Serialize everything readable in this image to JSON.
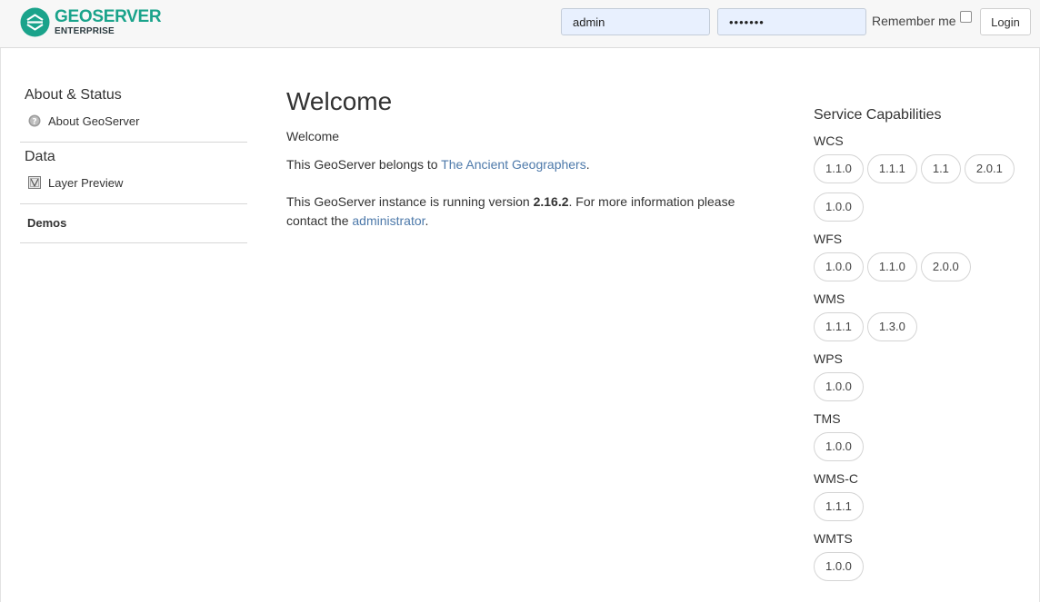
{
  "header": {
    "logo_title": "GEOSERVER",
    "logo_subtitle": "ENTERPRISE",
    "username_value": "admin",
    "password_value": "•••••••",
    "remember_label": "Remember me",
    "remember_checked": false,
    "login_label": "Login"
  },
  "sidebar": {
    "sections": [
      {
        "title": "About & Status",
        "items": [
          {
            "label": "About GeoServer",
            "icon": "help-circle-icon"
          }
        ]
      },
      {
        "title": "Data",
        "items": [
          {
            "label": "Layer Preview",
            "icon": "layer-preview-icon"
          }
        ]
      }
    ],
    "demos_label": "Demos"
  },
  "main": {
    "heading": "Welcome",
    "intro": "Welcome",
    "belongs_prefix": "This GeoServer belongs to ",
    "belongs_link": "The Ancient Geographers",
    "belongs_suffix": ".",
    "version_prefix": "This GeoServer instance is running version ",
    "version": "2.16.2",
    "version_suffix": ". For more information please contact the ",
    "admin_link": "administrator",
    "admin_suffix": "."
  },
  "capabilities": {
    "title": "Service Capabilities",
    "services": [
      {
        "name": "WCS",
        "versions": [
          "1.1.0",
          "1.1.1",
          "1.1",
          "2.0.1",
          "1.0.0"
        ]
      },
      {
        "name": "WFS",
        "versions": [
          "1.0.0",
          "1.1.0",
          "2.0.0"
        ]
      },
      {
        "name": "WMS",
        "versions": [
          "1.1.1",
          "1.3.0"
        ]
      },
      {
        "name": "WPS",
        "versions": [
          "1.0.0"
        ]
      },
      {
        "name": "TMS",
        "versions": [
          "1.0.0"
        ]
      },
      {
        "name": "WMS-C",
        "versions": [
          "1.1.1"
        ]
      },
      {
        "name": "WMTS",
        "versions": [
          "1.0.0"
        ]
      }
    ]
  },
  "colors": {
    "brand": "#1aa38b",
    "link": "#4d79aa",
    "input_bg": "#e8f0fe"
  }
}
